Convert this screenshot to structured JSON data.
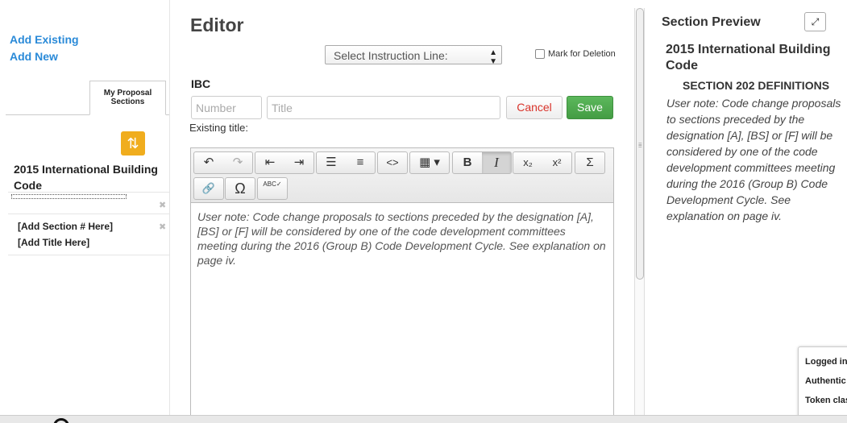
{
  "left": {
    "add_existing": "Add Existing",
    "add_new": "Add New",
    "tab_label": "My Proposal Sections",
    "book_title": "2015 International Building Code",
    "sections": [
      {
        "label": "[Add Section # Here]"
      },
      {
        "label": "[Add Title Here]"
      }
    ]
  },
  "editor": {
    "title": "Editor",
    "select_label": "Select Instruction Line:",
    "mark_deletion": "Mark for Deletion",
    "code": "IBC",
    "number_placeholder": "Number",
    "title_placeholder": "Title",
    "cancel": "Cancel",
    "save": "Save",
    "existing_title": "Existing title:",
    "toolbar": {
      "undo": "↶",
      "redo": "↷",
      "outdent": "⇤",
      "indent": "⇥",
      "bullets": "☰",
      "numbers": "≡",
      "source": "<>",
      "table": "▦ ▾",
      "bold": "B",
      "italic": "I",
      "subscript": "x₂",
      "superscript": "x²",
      "sigma": "Σ",
      "link": "🔗",
      "omega": "Ω",
      "spell": "ABC✓"
    },
    "content": "User note: Code change proposals to sections preceded by the designation [A], [BS] or [F] will be considered by one of the code development committees meeting during the 2016 (Group B) Code Development Cycle. See explanation on page iv."
  },
  "preview": {
    "title": "Section Preview",
    "expand": "⤢",
    "book": "2015 International Building Code",
    "section": "SECTION 202 DEFINITIONS",
    "note": "User note: Code change proposals to sections preceded by the designation [A], [BS] or [F] will be considered by one of the code development committees meeting during the 2016 (Group B) Code Development Cycle. See explanation on page iv."
  },
  "auth": {
    "line1": "Logged in",
    "line2": "Authentic",
    "line3": "Token clas"
  }
}
